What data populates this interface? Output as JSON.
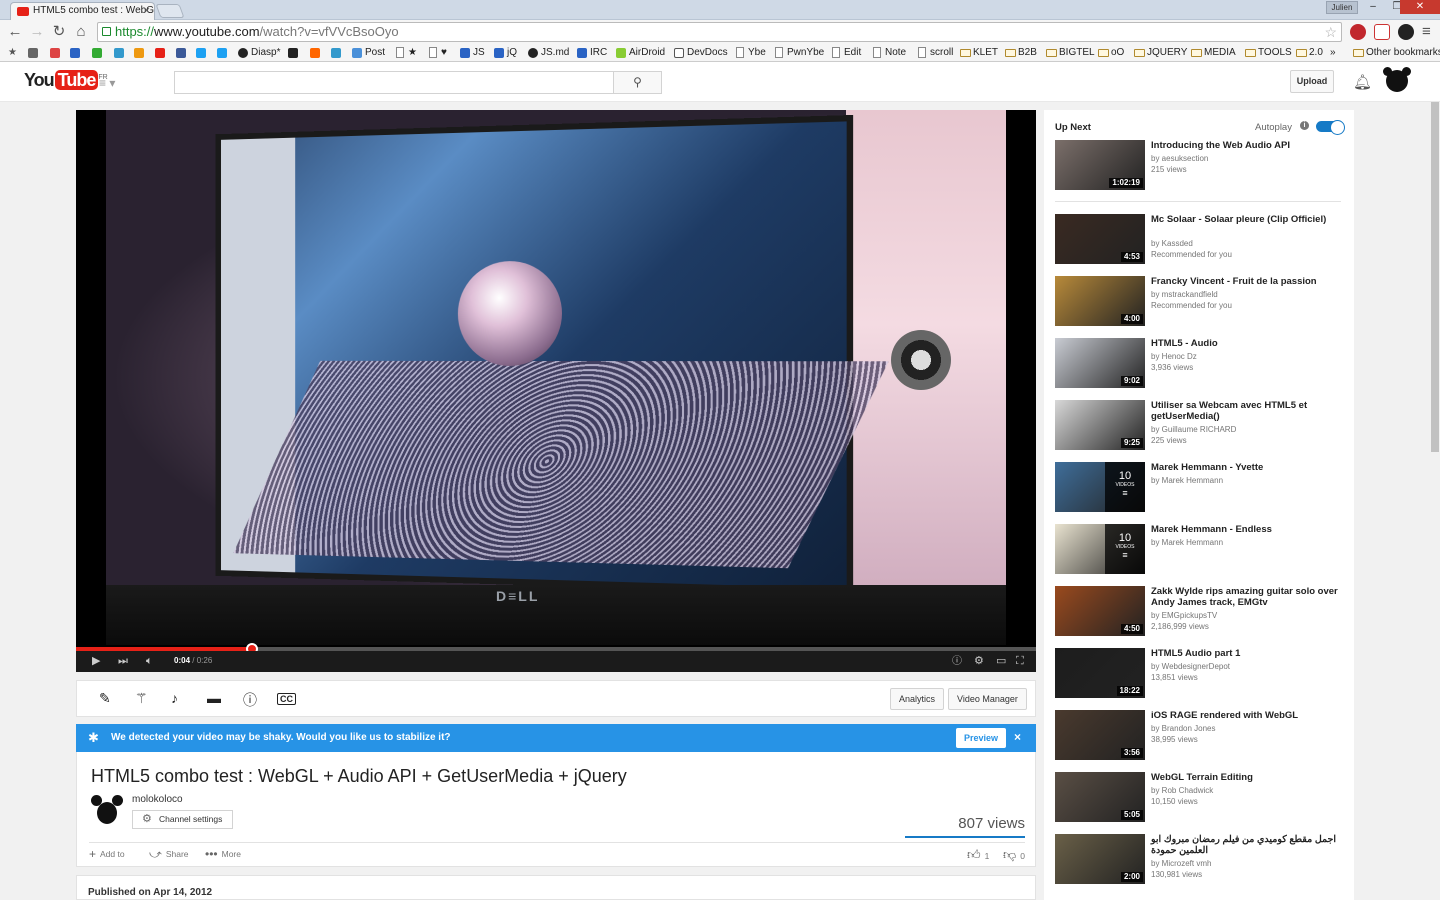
{
  "browser": {
    "tab_title": "HTML5 combo test : WebG",
    "user": "Julien",
    "url_scheme": "https://",
    "url_host": "www.youtube.com",
    "url_path": "/watch?v=vfVVcBsoOyo",
    "bookmarks": [
      "Diasp*",
      "Post",
      "JS",
      "jQ",
      "JS.md",
      "IRC",
      "AirDroid",
      "DevDocs",
      "Ybe",
      "PwnYbe",
      "Edit",
      "Note",
      "scroll",
      "KLET",
      "B2B",
      "BIGTEL",
      "oO",
      "JQUERY",
      "MEDIA",
      "TOOLS",
      "2.0",
      "»",
      "Other bookmarks"
    ]
  },
  "yt": {
    "logo_you": "You",
    "logo_tube": "Tube",
    "logo_region": "FR",
    "search_placeholder": "",
    "upload_label": "Upload"
  },
  "player": {
    "current_time": "0:04",
    "duration": "/ 0:26",
    "progress": 0.183,
    "laptop_brand": "D≡LL"
  },
  "edit_bar": {
    "analytics": "Analytics",
    "video_manager": "Video Manager"
  },
  "stabilize": {
    "message": "We detected your video may be shaky. Would you like us to stabilize it?",
    "preview": "Preview",
    "close": "×"
  },
  "video": {
    "title": "HTML5 combo test : WebGL + Audio API + GetUserMedia + jQuery",
    "channel": "molokoloco",
    "channel_settings": "Channel settings",
    "views": "807 views",
    "add_to": "Add to",
    "share": "Share",
    "more": "More",
    "likes": "1",
    "dislikes": "0",
    "published": "Published on Apr 14, 2012"
  },
  "sidebar": {
    "up_next": "Up Next",
    "autoplay": "Autoplay",
    "items": [
      {
        "title": "Introducing the Web Audio API",
        "by": "by aesuksection",
        "meta": "215 views",
        "duration": "1:02:19",
        "color": "#7b6f6a"
      },
      {
        "title": "Mc Solaar - Solaar pleure (Clip Officiel)",
        "by": "by Kassded",
        "meta": "Recommended for you",
        "duration": "4:53",
        "color": "#3a2a22"
      },
      {
        "title": "Francky Vincent - Fruit de la passion",
        "by": "by mstrackandfield",
        "meta": "Recommended for you",
        "duration": "4:00",
        "color": "#b88a3a"
      },
      {
        "title": "HTML5 - Audio",
        "by": "by Henoc Dz",
        "meta": "3,936 views",
        "duration": "9:02",
        "color": "#c9ccd3"
      },
      {
        "title": "Utiliser sa Webcam avec HTML5 et getUserMedia()",
        "by": "by Guillaume RICHARD",
        "meta": "225 views",
        "duration": "9:25",
        "color": "#d8d8d8"
      },
      {
        "title": "Marek Hemmann - Yvette",
        "by": "by Marek Hemmann",
        "meta": "",
        "playlist_count": "10",
        "playlist_label": "VIDEOS",
        "color": "#3f6e9a"
      },
      {
        "title": "Marek Hemmann - Endless",
        "by": "by Marek Hemmann",
        "meta": "",
        "playlist_count": "10",
        "playlist_label": "VIDEOS",
        "color": "#e9e3d0"
      },
      {
        "title": "Zakk Wylde rips amazing guitar solo over Andy James track, EMGtv",
        "by": "by EMGpickupsTV",
        "meta": "2,186,999 views",
        "duration": "4:50",
        "color": "#9a4a1e"
      },
      {
        "title": "HTML5 Audio part 1",
        "by": "by WebdesignerDepot",
        "meta": "13,851 views",
        "duration": "18:22",
        "color": "#1d1d1d"
      },
      {
        "title": "iOS RAGE rendered with WebGL",
        "by": "by Brandon Jones",
        "meta": "38,995 views",
        "duration": "3:56",
        "color": "#4a3a2e"
      },
      {
        "title": "WebGL Terrain Editing",
        "by": "by Rob Chadwick",
        "meta": "10,150 views",
        "duration": "5:05",
        "color": "#5a4f45"
      },
      {
        "title": "اجمل مقطع كوميدي من فيلم رمضان مبروك ابو العلمين حمودة",
        "by": "by Microzeft vmh",
        "meta": "130,981 views",
        "duration": "2:00",
        "color": "#6a6048"
      }
    ]
  }
}
